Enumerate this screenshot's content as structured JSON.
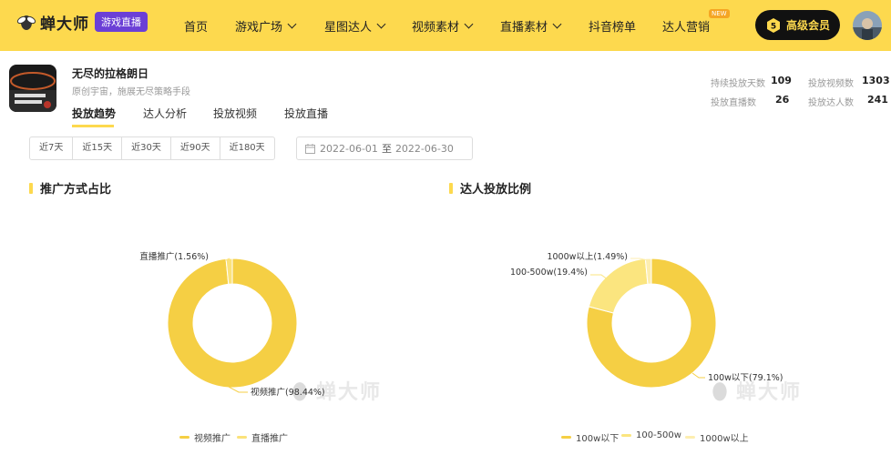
{
  "brand": {
    "name": "蝉大师",
    "badge": "游戏直播"
  },
  "nav": {
    "home": "首页",
    "game_square": "游戏广场",
    "star_talent": "星图达人",
    "video_material": "视频素材",
    "live_material": "直播素材",
    "douyin_rank": "抖音榜单",
    "talent_marketing": "达人营销",
    "new_badge": "NEW",
    "vip_label": "高级会员"
  },
  "game": {
    "title": "无尽的拉格朗日",
    "subtitle": "原创宇宙，施展无尽策略手段",
    "tabs": [
      "投放趋势",
      "达人分析",
      "投放视频",
      "投放直播"
    ]
  },
  "stats": {
    "continuous_days_label": "持续投放天数",
    "continuous_days": "109",
    "videos_label": "投放视频数",
    "videos": "1303",
    "live_label": "投放直播数",
    "live": "26",
    "talents_label": "投放达人数",
    "talents": "241"
  },
  "filters": {
    "ranges": [
      "近7天",
      "近15天",
      "近30天",
      "近90天",
      "近180天"
    ],
    "date_start": "2022-06-01",
    "date_sep": "至",
    "date_end": "2022-06-30"
  },
  "watermark": "蝉大师",
  "colors": {
    "accent": "#fdd94e",
    "vip_bg": "#111111",
    "badge": "#6b3fd6"
  },
  "chart_data": [
    {
      "type": "pie",
      "title": "推广方式占比",
      "donut": true,
      "slices": [
        {
          "name": "视频推广",
          "value": 98.44,
          "label": "视频推广(98.44%)",
          "color": "#f5cf44"
        },
        {
          "name": "直播推广",
          "value": 1.56,
          "label": "直播推广(1.56%)",
          "color": "#fbe27a"
        }
      ],
      "legend": "bottom"
    },
    {
      "type": "pie",
      "title": "达人投放比例",
      "donut": true,
      "slices": [
        {
          "name": "100w以下",
          "value": 79.1,
          "label": "100w以下(79.1%)",
          "color": "#f5cf44"
        },
        {
          "name": "100-500w",
          "value": 19.4,
          "label": "100-500w(19.4%)",
          "color": "#fbe57f"
        },
        {
          "name": "1000w以上",
          "value": 1.49,
          "label": "1000w以上(1.49%)",
          "color": "#fdeeb0"
        }
      ],
      "legend": "bottom"
    }
  ]
}
